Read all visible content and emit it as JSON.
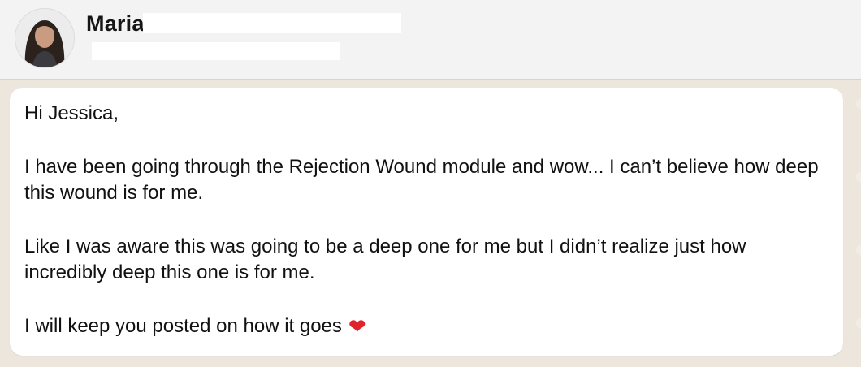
{
  "header": {
    "contact_name": "Maria"
  },
  "message": {
    "greeting": "Hi Jessica,",
    "paragraph_1": "I have been going through the Rejection Wound module and wow... I can’t believe how deep this wound is for me.",
    "paragraph_2": "Like I was aware this was going to be a deep one for me but I didn’t realize just how incredibly deep this one is for me.",
    "paragraph_3": "I will keep you posted on how it goes",
    "emoji": "❤"
  },
  "icons": {
    "avatar": "contact-avatar",
    "heart": "heart-icon"
  },
  "colors": {
    "header_bg": "#f3f3f3",
    "chat_bg": "#ece6dc",
    "bubble_bg": "#ffffff",
    "heart": "#e0242c"
  }
}
